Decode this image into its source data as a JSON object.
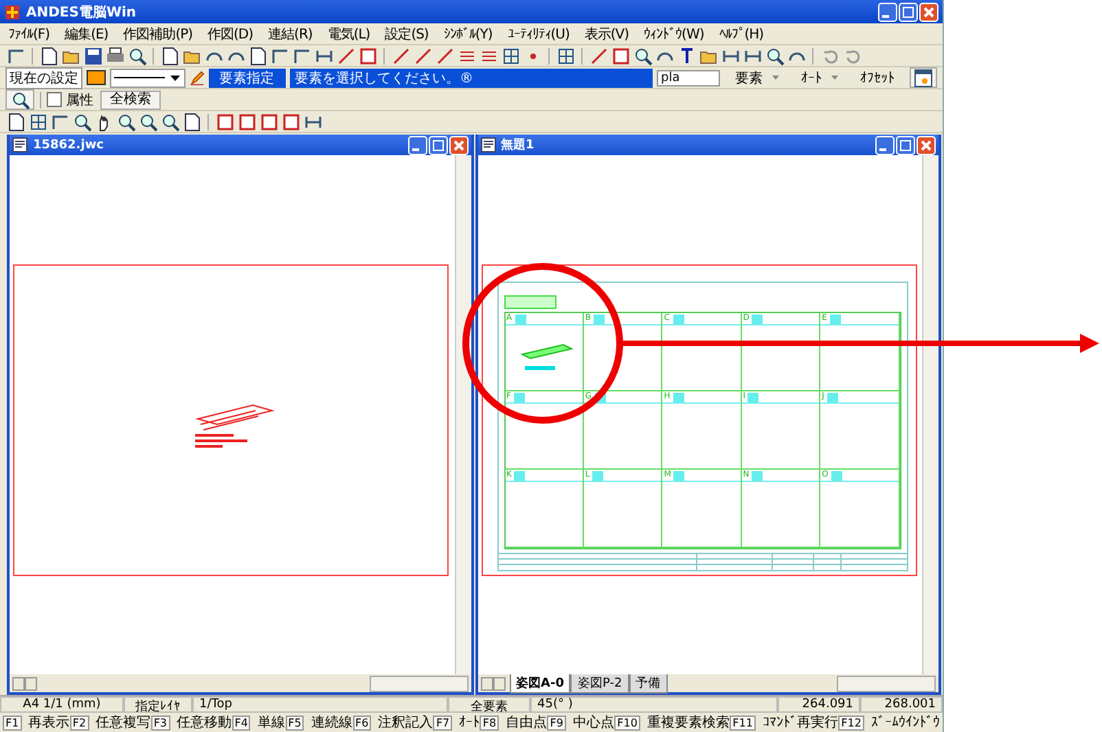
{
  "window": {
    "title": "ANDES電脳Win"
  },
  "menu": [
    "ﾌｧｲﾙ(F)",
    "編集(E)",
    "作図補助(P)",
    "作図(D)",
    "連結(R)",
    "電気(L)",
    "設定(S)",
    "ｼﾝﾎﾞﾙ(Y)",
    "ﾕｰﾃｨﾘﾃｨ(U)",
    "表示(V)",
    "ｳｨﾝﾄﾞｳ(W)",
    "ﾍﾙﾌﾟ(H)"
  ],
  "settings_bar": {
    "label": "現在の設定",
    "mode": "要素指定",
    "prompt": "要素を選択してください。®",
    "input": "pla",
    "dropdowns": [
      "要素",
      "ｵｰﾄ"
    ],
    "offset": "ｵﾌｾｯﾄ"
  },
  "search_bar": {
    "attribute": {
      "label": "属性",
      "checked": false
    },
    "button": "全検索"
  },
  "documents": [
    {
      "title": "15862.jwc",
      "kind": "part"
    },
    {
      "title": "無題1",
      "kind": "sheet",
      "grid_cells": [
        "A",
        "B",
        "C",
        "D",
        "E",
        "F",
        "G",
        "H",
        "I",
        "J",
        "K",
        "L",
        "M",
        "N",
        "O"
      ],
      "sheet_tabs": [
        {
          "label": "姿図A-0",
          "selected": true
        },
        {
          "label": "姿図P-2",
          "selected": false
        },
        {
          "label": "予備",
          "selected": false
        }
      ]
    }
  ],
  "status_bar": [
    "A4 1/1 (mm)",
    "指定ﾚｲﾔ",
    "1/Top",
    "全要素",
    "45(° )",
    "264.091",
    "268.001"
  ],
  "function_keys": [
    {
      "key": "F1",
      "label": "再表示"
    },
    {
      "key": "F2",
      "label": "任意複写"
    },
    {
      "key": "F3",
      "label": "任意移動"
    },
    {
      "key": "F4",
      "label": "単線"
    },
    {
      "key": "F5",
      "label": "連続線"
    },
    {
      "key": "F6",
      "label": "注釈記入"
    },
    {
      "key": "F7",
      "label": "ｵｰﾄ"
    },
    {
      "key": "F8",
      "label": "自由点"
    },
    {
      "key": "F9",
      "label": "中心点"
    },
    {
      "key": "F10",
      "label": "重複要素検索"
    },
    {
      "key": "F11",
      "label": "ｺﾏﾝﾄﾞ再実行"
    },
    {
      "key": "F12",
      "label": "ｽﾞｰﾑｳｲﾝﾄﾞｳ"
    }
  ]
}
